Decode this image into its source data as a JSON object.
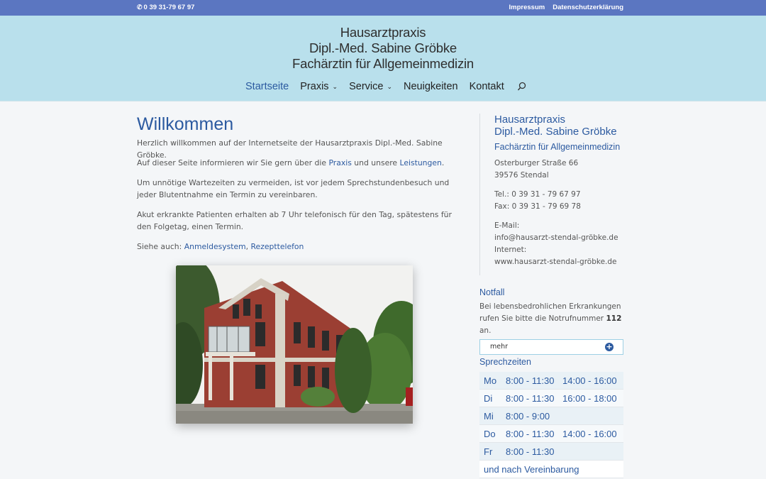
{
  "topbar": {
    "phone": "0 39 31-79 67 97",
    "links": [
      "Impressum",
      "Datenschutzerklärung"
    ]
  },
  "logo": {
    "line1": "Hausarztpraxis",
    "line2": "Dipl.-Med. Sabine Gröbke",
    "line3": "Fachärztin für Allgemeinmedizin"
  },
  "nav": {
    "items": [
      {
        "label": "Startseite",
        "active": true
      },
      {
        "label": "Praxis",
        "dropdown": true
      },
      {
        "label": "Service",
        "dropdown": true
      },
      {
        "label": "Neuigkeiten"
      },
      {
        "label": "Kontakt"
      }
    ]
  },
  "main": {
    "title": "Willkommen",
    "p1": "Herzlich willkommen auf der Internetseite der Hausarztpraxis Dipl.-Med. Sabine Gröbke.",
    "p2_a": "Auf dieser Seite informieren wir Sie gern über die ",
    "p2_link1": "Praxis",
    "p2_b": " und unsere ",
    "p2_link2": "Leistungen",
    "p2_c": ".",
    "p3": "Um unnötige Wartezeiten zu vermeiden, ist vor jedem Sprechstundenbesuch und jeder Blutentnahme ein Termin zu vereinbaren.",
    "p4": "Akut erkrankte Patienten erhalten ab 7 Uhr telefonisch für den Tag, spätestens für den Folgetag, einen Termin.",
    "p5_a": "Siehe auch: ",
    "p5_link1": "Anmeldesystem",
    "p5_b": ", ",
    "p5_link2": "Rezepttelefon"
  },
  "sidebar": {
    "title1": "Hausarztpraxis",
    "title2": "Dipl.-Med. Sabine Gröbke",
    "subtitle": "Fachärztin für Allgemeinmedizin",
    "street": "Osterburger Straße 66",
    "city": "39576 Stendal",
    "tel": "Tel.: 0 39 31 - 79 67 97",
    "fax": "Fax: 0 39 31 - 79 69 78",
    "email_label": "E-Mail:",
    "email": "info@hausarzt-stendal-gröbke.de",
    "internet_label": "Internet:",
    "internet": "www.hausarzt-stendal-gröbke.de"
  },
  "notfall": {
    "heading": "Notfall",
    "text_a": "Bei lebensbedrohlichen Erkrankungen rufen Sie bitte die Notrufnummer ",
    "number": "112",
    "text_b": " an.",
    "more": "mehr",
    "more_icon": "plus-circle-icon"
  },
  "sprechzeiten": {
    "heading": "Sprechzeiten",
    "rows": [
      {
        "day": "Mo",
        "morning": "8:00 - 11:30",
        "afternoon": "14:00 - 16:00"
      },
      {
        "day": "Di",
        "morning": "8:00 - 11:30",
        "afternoon": "16:00 - 18:00"
      },
      {
        "day": "Mi",
        "morning": "8:00 - 9:00",
        "afternoon": ""
      },
      {
        "day": "Do",
        "morning": "8:00 - 11:30",
        "afternoon": "14:00 - 16:00"
      },
      {
        "day": "Fr",
        "morning": "8:00 - 11:30",
        "afternoon": ""
      }
    ],
    "footer": "und nach Vereinbarung"
  },
  "colors": {
    "topbar": "#5b76c1",
    "header": "#b9e0ec",
    "accent": "#2c5aa0"
  }
}
